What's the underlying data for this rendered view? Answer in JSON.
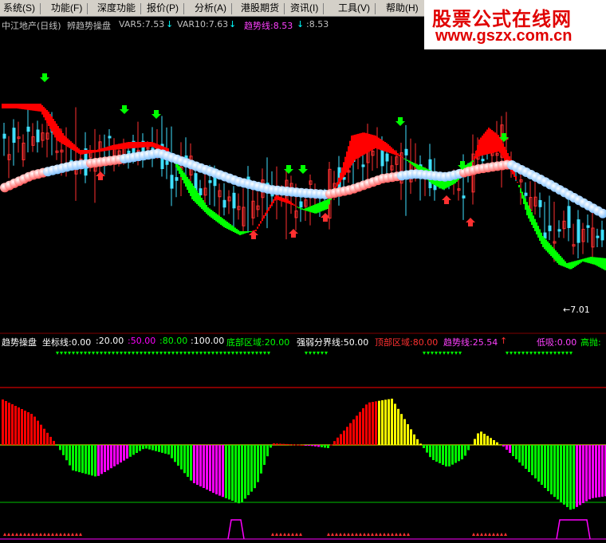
{
  "menu": [
    "系统(S)",
    "功能(F)",
    "深度功能",
    "报价(P)",
    "分析(A)",
    "港股期货",
    "资讯(I)",
    "工具(V)",
    "帮助(H)"
  ],
  "logo": {
    "line1": "股票公式在线网",
    "line2": "www.gszx.com.cn"
  },
  "main_panel": {
    "stock": "中江地产(日线)",
    "indicator": "辨趋势操盘",
    "var5": "VAR5:7.53",
    "var5_arrow": "↓",
    "var10": "VAR10:7.63",
    "var10_arrow": "↓",
    "trend": "趋势线:8.53",
    "trend_arrow": "↓",
    "last": ":8.53",
    "low_label": "←7.01"
  },
  "sub_panel": {
    "name": "趋势操盘",
    "coord_label": "坐标线:0.00",
    "c20": ":20.00",
    "c50": ":50.00",
    "c80": ":80.00",
    "c100": ":100.00",
    "bottom_zone": "底部区域:20.00",
    "divider": "强弱分界线:50.00",
    "top_zone": "顶部区域:80.00",
    "trend": "趋势线:25.54",
    "trend_arrow": "↑",
    "low_buy": "低吸:0.00",
    "high_sell": "高抛:"
  },
  "colors": {
    "ma_red": "#ff0000",
    "ma_green": "#00ff00",
    "balls_up": "#ff6060",
    "balls_down": "#80c0ff",
    "up_candle": "#ff3030",
    "down_candle": "#40e0ff",
    "magenta": "#ff00ff",
    "yellow": "#ffff00"
  }
}
